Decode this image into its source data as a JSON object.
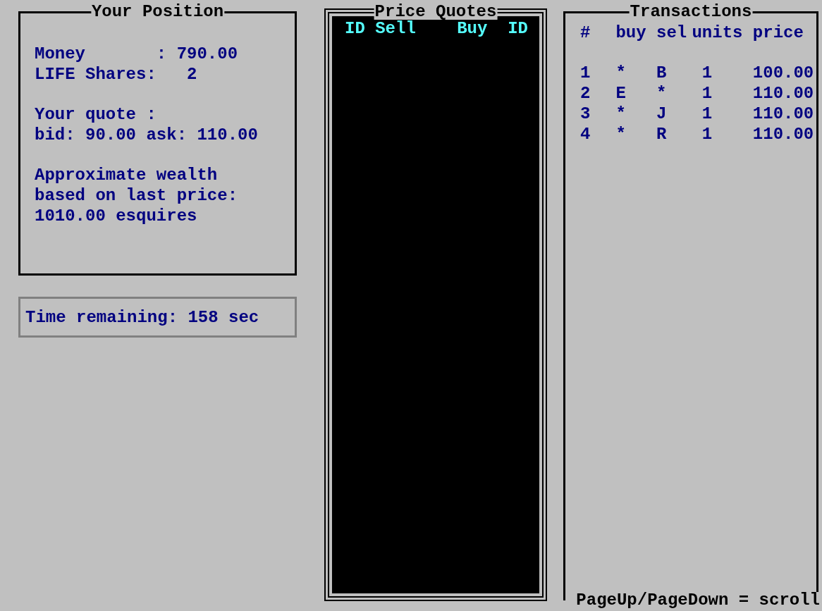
{
  "position": {
    "title": "Your Position",
    "paragraphs": [
      [
        "Money       : 790.00",
        "LIFE Shares:   2"
      ],
      [
        "Your quote :",
        "bid: 90.00 ask: 110.00"
      ],
      [
        "Approximate wealth",
        "based on last price:",
        "1010.00 esquires"
      ]
    ]
  },
  "timer": {
    "text": "Time remaining: 158 sec"
  },
  "price_quotes": {
    "title": "Price Quotes",
    "columns": [
      "ID",
      "Sell",
      "Buy",
      "ID"
    ]
  },
  "transactions": {
    "title": "Transactions",
    "columns": [
      "#",
      "buy",
      "sel",
      "units",
      "price"
    ],
    "rows": [
      [
        "1",
        "*",
        "B",
        "1",
        "100.00"
      ],
      [
        "2",
        "E",
        "*",
        "1",
        "110.00"
      ],
      [
        "3",
        "*",
        "J",
        "1",
        "110.00"
      ],
      [
        "4",
        "*",
        "R",
        "1",
        "110.00"
      ]
    ],
    "footer": "PageUp/PageDown = scroll"
  }
}
